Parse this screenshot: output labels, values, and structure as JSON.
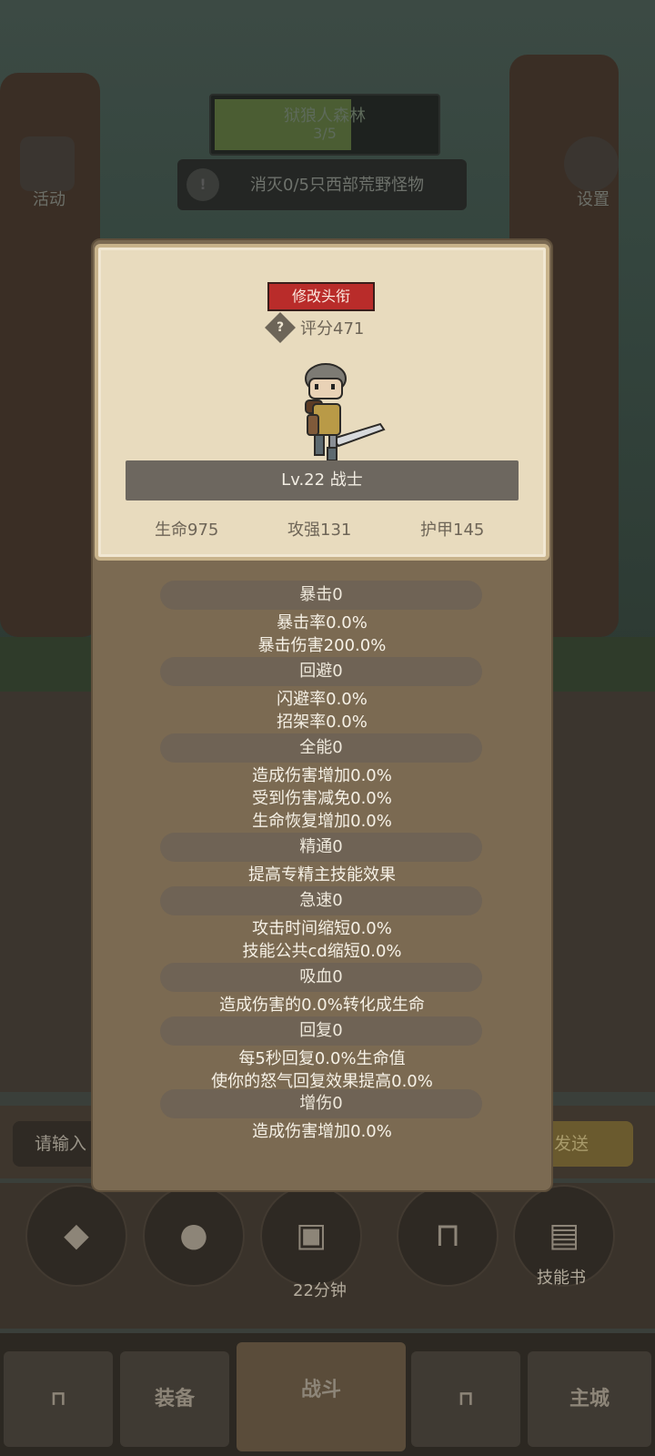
{
  "background": {
    "quest": {
      "name": "狱狼人森林",
      "progress": "3/5"
    },
    "task": "消灭0/5只西部荒野怪物",
    "left_corner_label": "活动",
    "right_corner_label": "设置",
    "chat_placeholder": "请输入",
    "send_label": "发送",
    "timer_label": "22分钟",
    "skillbook_label": "技能书",
    "nav": {
      "equip": "装备",
      "battle": "战斗",
      "city": "主城"
    }
  },
  "card": {
    "rename_button": "修改头衔",
    "help_icon": "?",
    "score": "评分471",
    "level": "Lv.22 战士",
    "stats": {
      "hp": "生命975",
      "atk": "攻强131",
      "armor": "护甲145"
    }
  },
  "attributes": [
    {
      "title": "暴击0",
      "lines": [
        "暴击率0.0%",
        "暴击伤害200.0%"
      ]
    },
    {
      "title": "回避0",
      "lines": [
        "闪避率0.0%",
        "招架率0.0%"
      ]
    },
    {
      "title": "全能0",
      "lines": [
        "造成伤害增加0.0%",
        "受到伤害减免0.0%",
        "生命恢复增加0.0%"
      ]
    },
    {
      "title": "精通0",
      "lines": [
        "提高专精主技能效果"
      ]
    },
    {
      "title": "急速0",
      "lines": [
        "攻击时间缩短0.0%",
        "技能公共cd缩短0.0%"
      ]
    },
    {
      "title": "吸血0",
      "lines": [
        "造成伤害的0.0%转化成生命"
      ]
    },
    {
      "title": "回复0",
      "lines": [
        "每5秒回复0.0%生命值",
        "使你的怒气回复效果提高0.0%"
      ]
    },
    {
      "title": "增伤0",
      "lines": [
        "造成伤害增加0.0%"
      ]
    }
  ]
}
